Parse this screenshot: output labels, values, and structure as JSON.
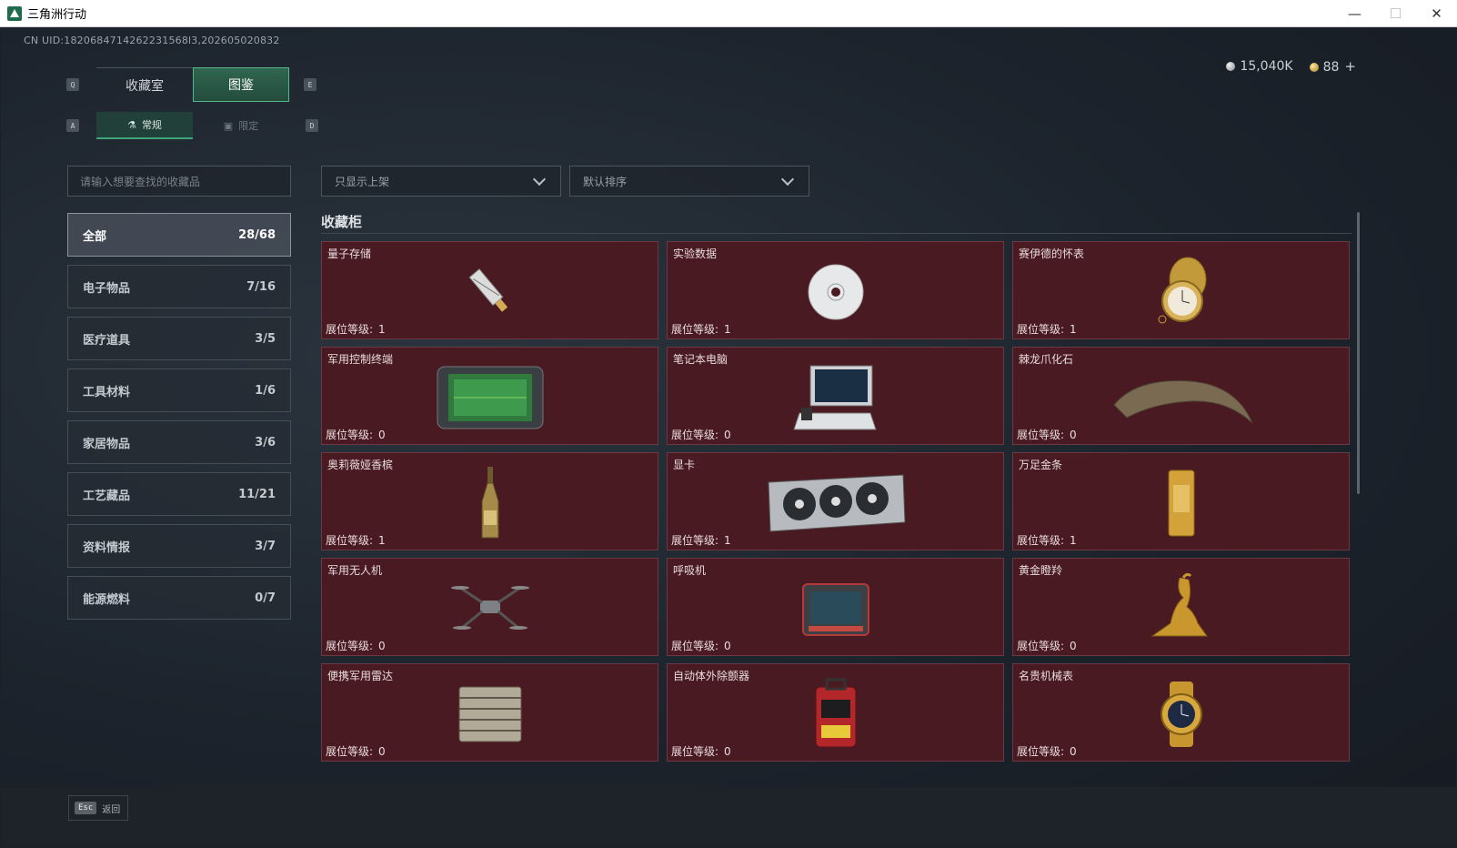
{
  "window": {
    "title": "三角洲行动",
    "minimize": "—",
    "maximize": "☐",
    "close": "✕"
  },
  "uid": "CN UID:1820684714262231568l3,202605020832",
  "currency": {
    "silver": "15,040K",
    "gold": "88",
    "plus": "+"
  },
  "keyhints": {
    "q": "Q",
    "e": "E",
    "a": "A",
    "d": "D"
  },
  "main_tabs": [
    {
      "label": "收藏室"
    },
    {
      "label": "图鉴"
    }
  ],
  "sub_tabs": [
    {
      "label": "常规"
    },
    {
      "label": "限定"
    }
  ],
  "search": {
    "placeholder": "请输入想要查找的收藏品"
  },
  "filters": {
    "shelf": "只显示上架",
    "sort": "默认排序"
  },
  "categories": [
    {
      "label": "全部",
      "count": "28/68"
    },
    {
      "label": "电子物品",
      "count": "7/16"
    },
    {
      "label": "医疗道具",
      "count": "3/5"
    },
    {
      "label": "工具材料",
      "count": "1/6"
    },
    {
      "label": "家居物品",
      "count": "3/6"
    },
    {
      "label": "工艺藏品",
      "count": "11/21"
    },
    {
      "label": "资料情报",
      "count": "3/7"
    },
    {
      "label": "能源燃料",
      "count": "0/7"
    }
  ],
  "section_title": "收藏柜",
  "level_label": "展位等级:",
  "items": [
    {
      "name": "量子存储",
      "level": "1",
      "icon": "usb-drive-icon"
    },
    {
      "name": "实验数据",
      "level": "1",
      "icon": "disc-icon"
    },
    {
      "name": "赛伊德的怀表",
      "level": "1",
      "icon": "pocket-watch-icon"
    },
    {
      "name": "军用控制终端",
      "level": "0",
      "icon": "control-terminal-icon"
    },
    {
      "name": "笔记本电脑",
      "level": "0",
      "icon": "laptop-icon"
    },
    {
      "name": "棘龙爪化石",
      "level": "0",
      "icon": "claw-fossil-icon"
    },
    {
      "name": "奥莉薇娅香槟",
      "level": "1",
      "icon": "champagne-icon"
    },
    {
      "name": "显卡",
      "level": "1",
      "icon": "graphics-card-icon"
    },
    {
      "name": "万足金条",
      "level": "1",
      "icon": "gold-bar-icon"
    },
    {
      "name": "军用无人机",
      "level": "0",
      "icon": "drone-icon"
    },
    {
      "name": "呼吸机",
      "level": "0",
      "icon": "ventilator-icon"
    },
    {
      "name": "黄金瞪羚",
      "level": "0",
      "icon": "gold-gazelle-icon"
    },
    {
      "name": "便携军用雷达",
      "level": "0",
      "icon": "radar-icon"
    },
    {
      "name": "自动体外除颤器",
      "level": "0",
      "icon": "defibrillator-icon"
    },
    {
      "name": "名贵机械表",
      "level": "0",
      "icon": "wristwatch-icon"
    }
  ],
  "esc": {
    "key": "Esc",
    "label": "返回"
  }
}
